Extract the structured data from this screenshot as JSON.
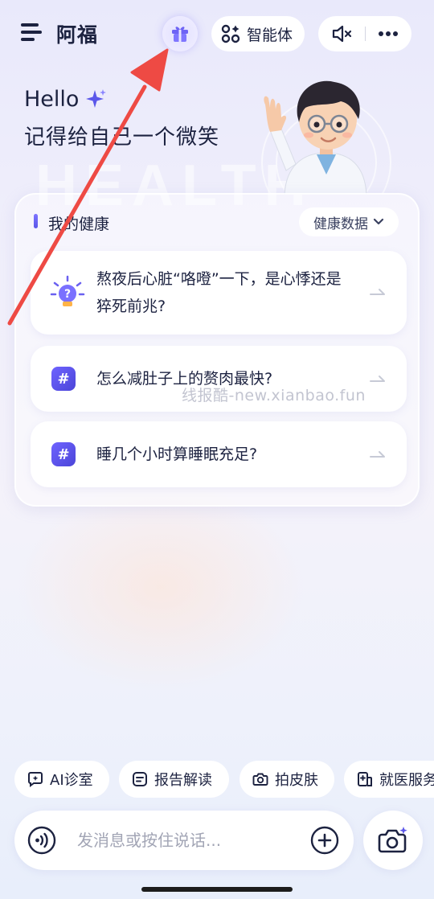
{
  "header": {
    "app_title": "阿福",
    "agent_label": "智能体",
    "icons": [
      "menu-icon",
      "gift-icon",
      "agent-icon",
      "mute-icon",
      "more-icon"
    ]
  },
  "greeting": {
    "hello": "Hello",
    "subtitle": "记得给自己一个微笑",
    "background_word": "HEALTH"
  },
  "health_card": {
    "title": "我的健康",
    "data_button": "健康数据",
    "questions": [
      {
        "icon": "lightbulb-icon",
        "text_line1": "熬夜后心脏“咯噔”一下，是心悸还是",
        "text_line2": "猝死前兆?"
      },
      {
        "icon": "hash-icon",
        "text": "怎么减肚子上的赘肉最快?"
      },
      {
        "icon": "hash-icon",
        "text": "睡几个小时算睡眠充足?"
      }
    ]
  },
  "watermark": "线报酷-new.xianbao.fun",
  "quick_chips": [
    {
      "label": "AI诊室",
      "icon": "ai-clinic-icon"
    },
    {
      "label": "报告解读",
      "icon": "report-icon"
    },
    {
      "label": "拍皮肤",
      "icon": "camera-icon"
    },
    {
      "label": "就医服务",
      "icon": "hospital-icon"
    }
  ],
  "input": {
    "placeholder": "发消息或按住说话..."
  },
  "colors": {
    "accent": "#5a56e8",
    "annotation_arrow": "#ee4a44",
    "text": "#1c2240"
  }
}
